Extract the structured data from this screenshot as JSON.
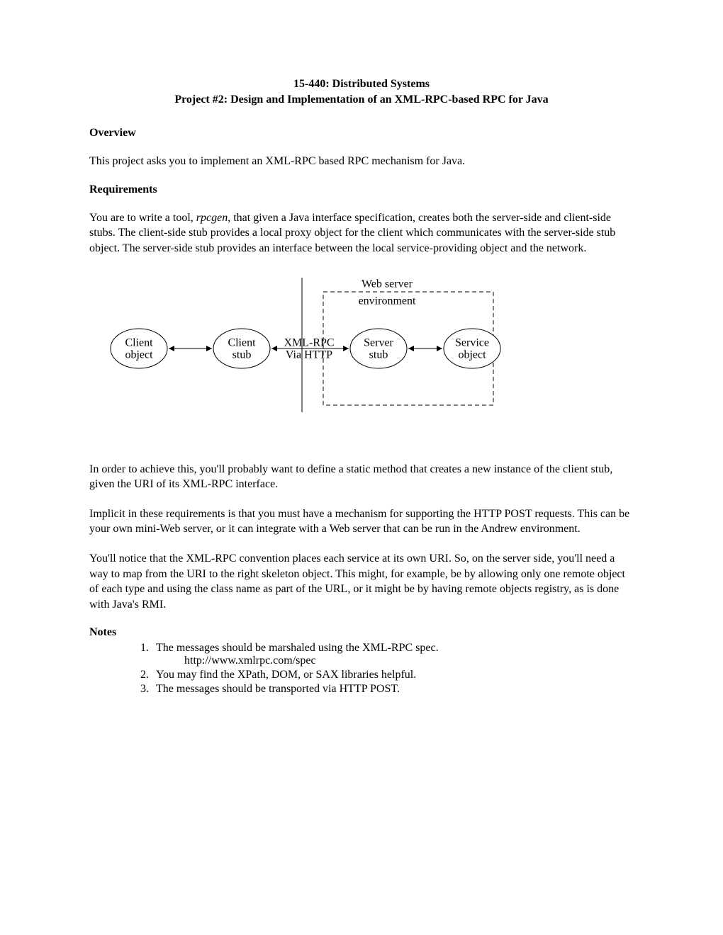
{
  "title_line1": "15-440: Distributed Systems",
  "title_line2": "Project #2: Design and Implementation of an XML-RPC-based RPC for Java",
  "overview_head": "Overview",
  "overview_text": "This project asks you to implement an XML-RPC based RPC mechanism for Java.",
  "requirements_head": "Requirements",
  "req_para1_a": "You are to write a tool, ",
  "req_para1_tool": "rpcgen",
  "req_para1_b": ", that given a Java interface specification, creates both the server-side and client-side stubs. The client-side stub provides a local proxy object for the client which communicates with the server-side stub object. The server-side stub provides an interface between the local service-providing object and the network.",
  "diagram": {
    "web_server_l1": "Web server",
    "web_server_l2": "environment",
    "client_object_l1": "Client",
    "client_object_l2": "object",
    "client_stub_l1": "Client",
    "client_stub_l2": "stub",
    "xmlrpc_l1": "XML-RPC",
    "xmlrpc_l2": "Via HTTP",
    "server_stub_l1": "Server",
    "server_stub_l2": "stub",
    "service_object_l1": "Service",
    "service_object_l2": "object"
  },
  "para2": "In order to achieve this, you'll probably want to define a static method that creates a new instance of the client stub, given the URI of its XML-RPC interface.",
  "para3": "Implicit in these requirements is that you must have a mechanism for supporting the HTTP POST requests. This can be your own mini-Web server, or it can integrate with a Web server that can be run in the Andrew environment.",
  "para4": "You'll notice that the XML-RPC convention places each service at its own URI. So, on the server side, you'll need a way to map from the URI to the right skeleton object. This might, for example, be by allowing only one remote object of each type and using the class name as part of the URL, or it might be by having remote objects registry, as is done with Java's RMI.",
  "notes_head": "Notes",
  "notes": {
    "n1": "The messages should be marshaled using the XML-RPC spec.",
    "n1_url": "http://www.xmlrpc.com/spec",
    "n2": "You may find the XPath, DOM, or SAX libraries helpful.",
    "n3": "The messages should be transported via HTTP POST."
  }
}
